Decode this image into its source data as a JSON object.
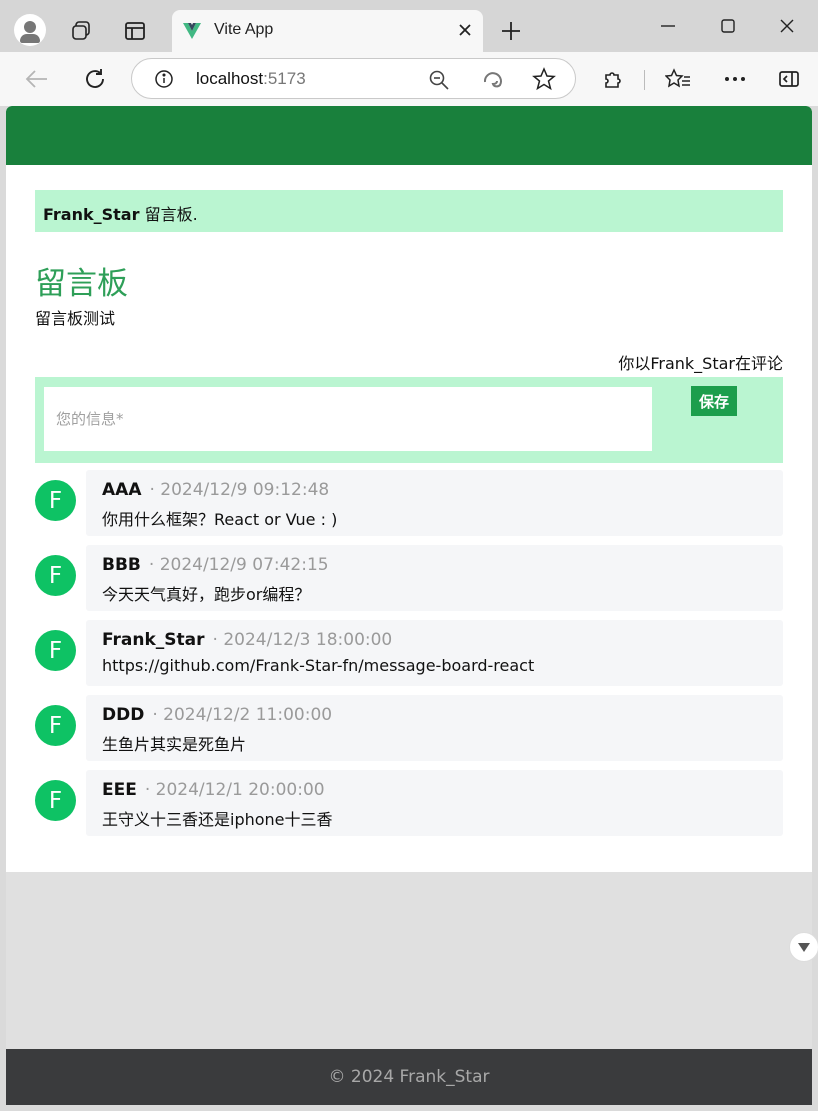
{
  "browser": {
    "tab_title": "Vite App",
    "url_host": "localhost",
    "url_port": ":5173"
  },
  "page": {
    "alert_user": "Frank_Star",
    "alert_text": " 留言板.",
    "title": "留言板",
    "subtitle": "留言板测试",
    "comment_as": "你以Frank_Star在评论",
    "input_placeholder": "您的信息*",
    "save_label": "保存",
    "footer": "© 2024 Frank_Star"
  },
  "comments": [
    {
      "avatar": "F",
      "author": "AAA",
      "time": "2024/12/9 09:12:48",
      "content": "你用什么框架？React or Vue : )"
    },
    {
      "avatar": "F",
      "author": "BBB",
      "time": "2024/12/9 07:42:15",
      "content": "今天天气真好，跑步or编程？"
    },
    {
      "avatar": "F",
      "author": "Frank_Star",
      "time": "2024/12/3 18:00:00",
      "content": "https://github.com/Frank-Star-fn/message-board-react"
    },
    {
      "avatar": "F",
      "author": "DDD",
      "time": "2024/12/2 11:00:00",
      "content": "生鱼片其实是死鱼片"
    },
    {
      "avatar": "F",
      "author": "EEE",
      "time": "2024/12/1 20:00:00",
      "content": "王守义十三香还是iphone十三香"
    }
  ],
  "colors": {
    "header_green": "#19803c",
    "alert_bg": "#baf5d1",
    "title_green": "#2e9f58",
    "avatar_green": "#0ec264",
    "save_button": "#1c9e4c",
    "footer_bg": "#3a3b3d"
  },
  "icons": {
    "profile": "profile-icon",
    "workspaces": "workspaces-icon",
    "tab_actions": "tab-actions-icon",
    "favicon": "vite-favicon-icon",
    "tab_close": "close-icon",
    "new_tab": "plus-icon",
    "back": "back-arrow-icon",
    "reload": "reload-icon",
    "site_info": "info-icon",
    "zoom": "zoom-out-icon",
    "edge": "edge-icon",
    "favorite": "star-icon",
    "extensions": "puzzle-icon",
    "favorites": "favorites-icon",
    "more": "more-icon",
    "sidebar": "sidebar-icon",
    "scroll": "chevron-down-icon"
  }
}
